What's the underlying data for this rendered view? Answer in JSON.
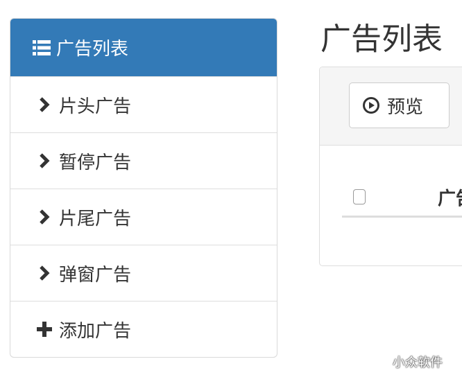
{
  "sidebar": {
    "items": [
      {
        "label": "广告列表",
        "icon": "list-icon",
        "active": true
      },
      {
        "label": "片头广告",
        "icon": "chevron-right-icon"
      },
      {
        "label": "暂停广告",
        "icon": "chevron-right-icon"
      },
      {
        "label": "片尾广告",
        "icon": "chevron-right-icon"
      },
      {
        "label": "弹窗广告",
        "icon": "chevron-right-icon"
      },
      {
        "label": "添加广告",
        "icon": "plus-icon"
      }
    ]
  },
  "main": {
    "title": "广告列表",
    "toolbar": {
      "preview_label": "预览",
      "preview_icon": "play-circle-icon"
    },
    "table": {
      "columns": [
        "广告"
      ]
    }
  },
  "watermark": {
    "text": "小众软件",
    "icon": "wechat-icon"
  },
  "colors": {
    "accent": "#337ab7",
    "border": "#dddddd",
    "panel_head": "#f5f5f5",
    "text": "#333333"
  }
}
